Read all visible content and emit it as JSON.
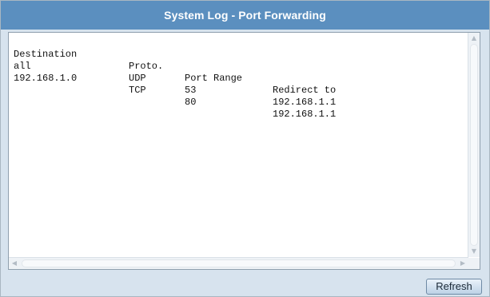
{
  "window": {
    "title": "System Log - Port Forwarding"
  },
  "log": {
    "columns": [
      "Destination",
      "Proto.",
      "Port Range",
      "Redirect to"
    ],
    "rows": [
      [
        "all",
        "UDP",
        "53",
        "192.168.1.1"
      ],
      [
        "192.168.1.0",
        "TCP",
        "80",
        "192.168.1.1"
      ]
    ]
  },
  "scrollbars": {
    "up_icon": "up-arrow-icon",
    "down_icon": "down-arrow-icon",
    "left_icon": "left-arrow-icon",
    "right_icon": "right-arrow-icon"
  },
  "actions": {
    "refresh_label": "Refresh"
  },
  "colors": {
    "titlebar": "#5b8fbf",
    "panel": "#d7e3ee"
  }
}
